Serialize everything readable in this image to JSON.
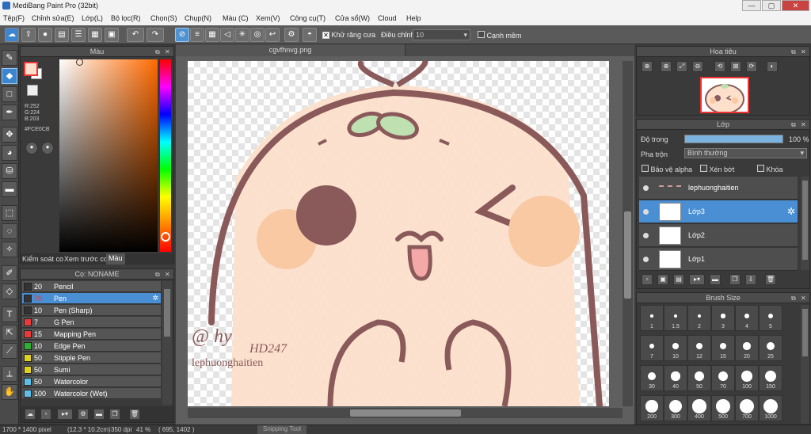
{
  "app": {
    "title": "MediBang Paint Pro (32bit)",
    "win_min": "—",
    "win_max": "▢",
    "win_close": "✕"
  },
  "menu": [
    "Tệp(F)",
    "Chỉnh sửa(E)",
    "Lớp(L)",
    "Bộ lọc(R)",
    "Chọn(S)",
    "Chụp(N)",
    "Màu (C)",
    "Xem(V)",
    "Công cụ(T)",
    "Cửa sổ(W)",
    "Cloud",
    "Help"
  ],
  "toolbar": {
    "antialias_label": "Khử răng cưa",
    "adjust_label": "Điều chỉnh",
    "adjust_value": "10",
    "smooth_label": "Cạnh mềm"
  },
  "color_panel": {
    "title": "Màu",
    "r": "R:252",
    "g": "G:224",
    "b": "B:203",
    "hex": "#FCE0CB",
    "tabs": [
      "Kiểm soát co",
      "Xem trước co",
      "Màu"
    ],
    "fg": "#FCE0CB"
  },
  "brush_panel": {
    "title": "Cọ: NONAME",
    "brushes": [
      {
        "size": "20",
        "name": "Pencil",
        "color": "#333333"
      },
      {
        "size": "70",
        "name": "Pen",
        "color": "#333333",
        "selected": true
      },
      {
        "size": "10",
        "name": "Pen (Sharp)",
        "color": "#333333"
      },
      {
        "size": "7",
        "name": "G Pen",
        "color": "#e83a3a"
      },
      {
        "size": "15",
        "name": "Mapping Pen",
        "color": "#e83a3a"
      },
      {
        "size": "10",
        "name": "Edge Pen",
        "color": "#30b030"
      },
      {
        "size": "50",
        "name": "Stipple Pen",
        "color": "#e0d020"
      },
      {
        "size": "50",
        "name": "Sumi",
        "color": "#e0d020"
      },
      {
        "size": "50",
        "name": "Watercolor",
        "color": "#5fbde8"
      },
      {
        "size": "100",
        "name": "Watercolor (Wet)",
        "color": "#5fbde8"
      }
    ]
  },
  "document": {
    "tab": "cgvfhnvg.png",
    "signature_name": "lephuonghaitien",
    "signature_tag": "HD247",
    "signature_at": "@ hy"
  },
  "navigator": {
    "title": "Hoa tiêu"
  },
  "layers": {
    "title": "Lớp",
    "opacity_label": "Độ trong",
    "opacity_value": "100 %",
    "opacity_fraction": 1.0,
    "blend_label": "Pha trộn",
    "blend_value": "Bình thường",
    "protect_alpha": "Bảo vệ alpha",
    "clipping": "Xén bớt",
    "lock": "Khóa",
    "items": [
      {
        "name": "lephuonghaitien",
        "selected": false
      },
      {
        "name": "Lớp3",
        "selected": true
      },
      {
        "name": "Lớp2",
        "selected": false
      },
      {
        "name": "Lớp1",
        "selected": false
      }
    ]
  },
  "brush_size": {
    "title": "Brush Size",
    "sizes": [
      "1",
      "1.5",
      "2",
      "3",
      "4",
      "5",
      "7",
      "10",
      "12",
      "15",
      "20",
      "25",
      "30",
      "40",
      "50",
      "70",
      "100",
      "150",
      "200",
      "300",
      "400",
      "500",
      "700",
      "1000"
    ]
  },
  "status": {
    "dims": "1700 * 1400 pixel",
    "cm": "(12.3 * 10.2cm)",
    "dpi": "350 dpi",
    "zoom": "41 %",
    "coord": "( 695, 1402 )",
    "taskbar": "Snipping Tool"
  }
}
